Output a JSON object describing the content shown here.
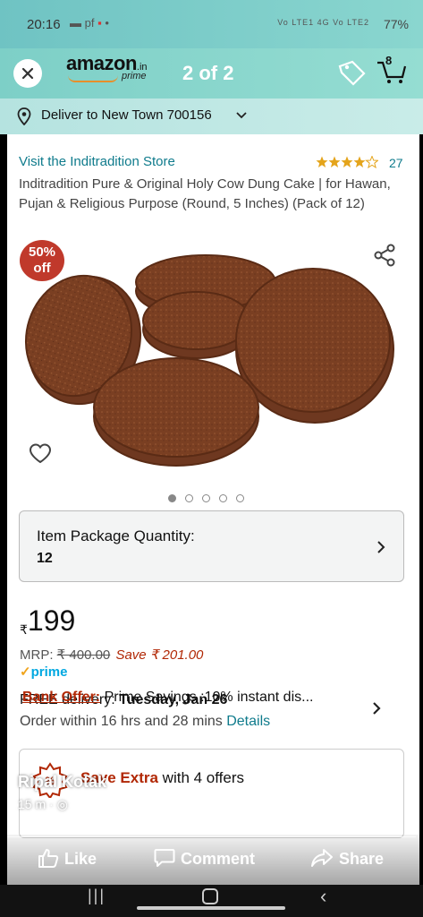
{
  "status_bar": {
    "time": "20:16",
    "notif_text": "pf",
    "network": "Vo LTE1 4G  Vo LTE2",
    "battery": "77%"
  },
  "header": {
    "brand": "amazon",
    "tld": ".in",
    "prime_label": "prime",
    "story_counter": "2 of 2",
    "cart_count": "8"
  },
  "delivery": {
    "text": "Deliver to New Town 700156"
  },
  "product": {
    "store_link": "Visit the Inditradition Store",
    "rating_stars": 4.5,
    "rating_count": "27",
    "title": "Inditradition Pure & Original Holy Cow Dung Cake | for Hawan, Pujan & Religious Purpose (Round, 5 Inches) (Pack of 12)",
    "discount_line1": "50%",
    "discount_line2": "off",
    "image_count": 5,
    "active_image": 0
  },
  "quantity": {
    "label": "Item Package Quantity:",
    "value": "12"
  },
  "pricing": {
    "currency": "₹",
    "price": "199",
    "mrp_label": "MRP: ",
    "mrp_value": "₹ 400.00",
    "save_text": "Save ₹ 201.00",
    "prime_text": "prime"
  },
  "delivery_info": {
    "free_prefix": "FREE delivery: ",
    "date": "Tuesday, Jan 26",
    "order_within": "Order within 16 hrs and 28 mins ",
    "details_link": "Details"
  },
  "offers": {
    "save_prefix": "Save Extra",
    "save_suffix": " with 4 offers",
    "bank_label": "Bank Offer:",
    "bank_text": " Prime Savings :10% instant dis..."
  },
  "story": {
    "author": "Ripal Kotak",
    "time": "15 m · ◎"
  },
  "actions": {
    "like": "Like",
    "comment": "Comment",
    "share": "Share"
  },
  "colors": {
    "header_teal": "#7dcfc7",
    "link": "#0f7b8c",
    "deal_red": "#b12704",
    "prime_blue": "#00a8e1",
    "star_orange": "#e4a41b"
  }
}
